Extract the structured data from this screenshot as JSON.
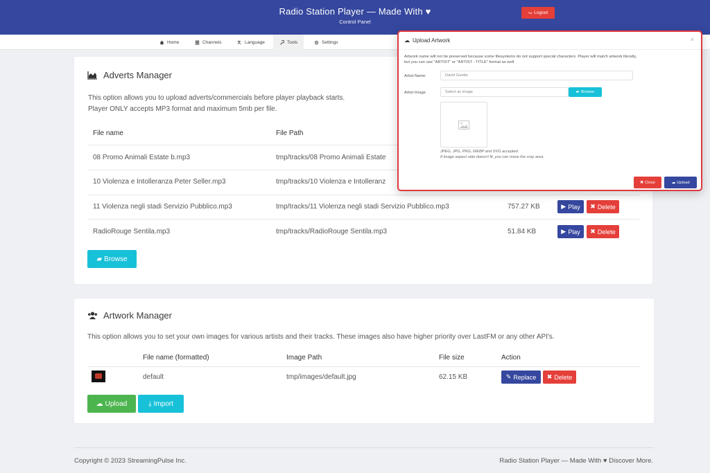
{
  "header": {
    "title": "Radio Station Player — Made With ♥",
    "subtitle": "Control Panel",
    "logout_label": "Logout"
  },
  "nav": {
    "items": [
      {
        "label": "Home",
        "icon": "home-icon"
      },
      {
        "label": "Channels",
        "icon": "channels-icon"
      },
      {
        "label": "Language",
        "icon": "language-icon"
      },
      {
        "label": "Tools",
        "icon": "wrench-icon"
      },
      {
        "label": "Settings",
        "icon": "gear-icon"
      }
    ],
    "active": "Tools"
  },
  "adverts": {
    "title": "Adverts Manager",
    "desc_line1": "This option allows you to upload adverts/commercials before player playback starts.",
    "desc_line2": "Player ONLY accepts MP3 format and maximum 5mb per file.",
    "columns": [
      "File name",
      "File Path"
    ],
    "rows": [
      {
        "name": "08 Promo Animali Estate b.mp3",
        "path": "tmp/tracks/08 Promo Animali Estate",
        "size": ""
      },
      {
        "name": "10 Violenza e Intolleranza Peter Seller.mp3",
        "path": "tmp/tracks/10 Violenza e Intolleranz",
        "size": ""
      },
      {
        "name": "11 Violenza negli stadi Servizio Pubblico.mp3",
        "path": "tmp/tracks/11 Violenza negli stadi Servizio Pubblico.mp3",
        "size": "757.27 KB"
      },
      {
        "name": "RadioRouge Sentila.mp3",
        "path": "tmp/tracks/RadioRouge Sentila.mp3",
        "size": "51.84 KB"
      }
    ],
    "play_label": "Play",
    "delete_label": "Delete",
    "browse_label": "Browse"
  },
  "artwork": {
    "title": "Artwork Manager",
    "desc": "This option allows you to set your own images for various artists and their tracks. These images also have higher priority over LastFM or any other API's.",
    "columns": [
      "File name (formatted)",
      "Image Path",
      "File size",
      "Action"
    ],
    "row": {
      "name": "default",
      "path": "tmp/images/default.jpg",
      "size": "62.15 KB"
    },
    "replace_label": "Replace",
    "delete_label": "Delete",
    "upload_label": "Upload",
    "import_label": "Import"
  },
  "footer": {
    "copyright": "Copyright © 2023 StreamingPulse Inc.",
    "right": "Radio Station Player — Made With ♥ Discover More."
  },
  "modal": {
    "title": "Upload Artwork",
    "note_line1": "Artwork name will not be preserved because some filesystems do not support special characters. Player will match artwork literally,",
    "note_line2": "but you can use \"ARTIST\" or \"ARTIST - TITLE\" format as well",
    "artist_label": "Artist Name:",
    "artist_value": "David Guetta",
    "image_label": "Artist Image",
    "image_placeholder": "Select an image",
    "browse_label": "Browse",
    "hint1": "JPEG, JPG, PNG, WEBP and SVG accepted.",
    "hint2": "If image aspect ratio doesn't fit, you can move the crop area.",
    "close_label": "Close",
    "upload_label": "Upload"
  },
  "colors": {
    "primary": "#35479e",
    "danger": "#e53f3a",
    "info": "#17c1d8",
    "success": "#4db54f"
  }
}
